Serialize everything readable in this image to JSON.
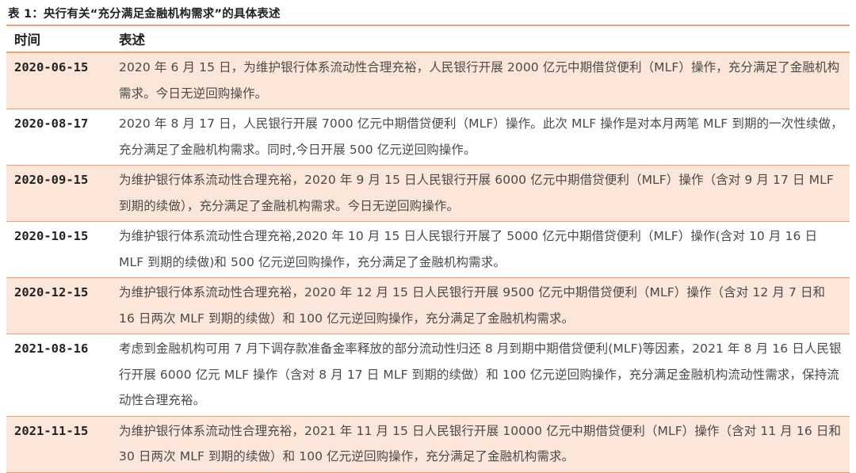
{
  "caption": "表 1：央行有关“充分满足金融机构需求”的具体表述",
  "header": {
    "col_time": "时间",
    "col_desc": "表述"
  },
  "rows": [
    {
      "date": "2020-06-15",
      "text": "2020 年 6 月 15 日，为维护银行体系流动性合理充裕，人民银行开展 2000 亿元中期借贷便利（MLF）操作，充分满足了金融机构需求。今日无逆回购操作。"
    },
    {
      "date": "2020-08-17",
      "text": "2020 年 8 月 17 日，人民银行开展 7000 亿元中期借贷便利（MLF）操作。此次 MLF 操作是对本月两笔 MLF 到期的一次性续做，充分满足了金融机构需求。同时,今日开展 500 亿元逆回购操作。"
    },
    {
      "date": "2020-09-15",
      "text": "为维护银行体系流动性合理充裕，2020 年 9 月 15 日人民银行开展 6000 亿元中期借贷便利（MLF）操作（含对 9 月 17 日 MLF 到期的续做），充分满足了金融机构需求。今日无逆回购操作。"
    },
    {
      "date": "2020-10-15",
      "text": "为维护银行体系流动性合理充裕,2020 年 10 月 15 日人民银行开展了 5000 亿元中期借贷便利（MLF）操作(含对 10 月 16 日 MLF 到期的续做)和 500 亿元逆回购操作，充分满足了金融机构需求。"
    },
    {
      "date": "2020-12-15",
      "text": "为维护银行体系流动性合理充裕，2020 年 12 月 15 日人民银行开展 9500 亿元中期借贷便利（MLF）操作（含对 12 月 7 日和 16 日两次 MLF 到期的续做）和 100 亿元逆回购操作，充分满足了金融机构需求。"
    },
    {
      "date": "2021-08-16",
      "text": "考虑到金融机构可用 7 月下调存款准备金率释放的部分流动性归还 8 月到期中期借贷便利(MLF)等因素，2021 年 8 月 16 日人民银行开展 6000 亿元 MLF 操作（含对 8 月 17 日 MLF 到期的续做）和 100 亿元逆回购操作，充分满足金融机构流动性需求，保持流动性合理充裕。"
    },
    {
      "date": "2021-11-15",
      "text": "为维护银行体系流动性合理充裕，2021 年 11 月 15 日人民银行开展 10000 亿元中期借贷便利（MLF）操作（含对 11 月 16 日和 30 日两次 MLF 到期的续做）和 100 亿元逆回购操作，充分满足了金融机构需求。"
    }
  ],
  "colors": {
    "accent": "#f0a070",
    "shade": "#fbe6d9"
  }
}
